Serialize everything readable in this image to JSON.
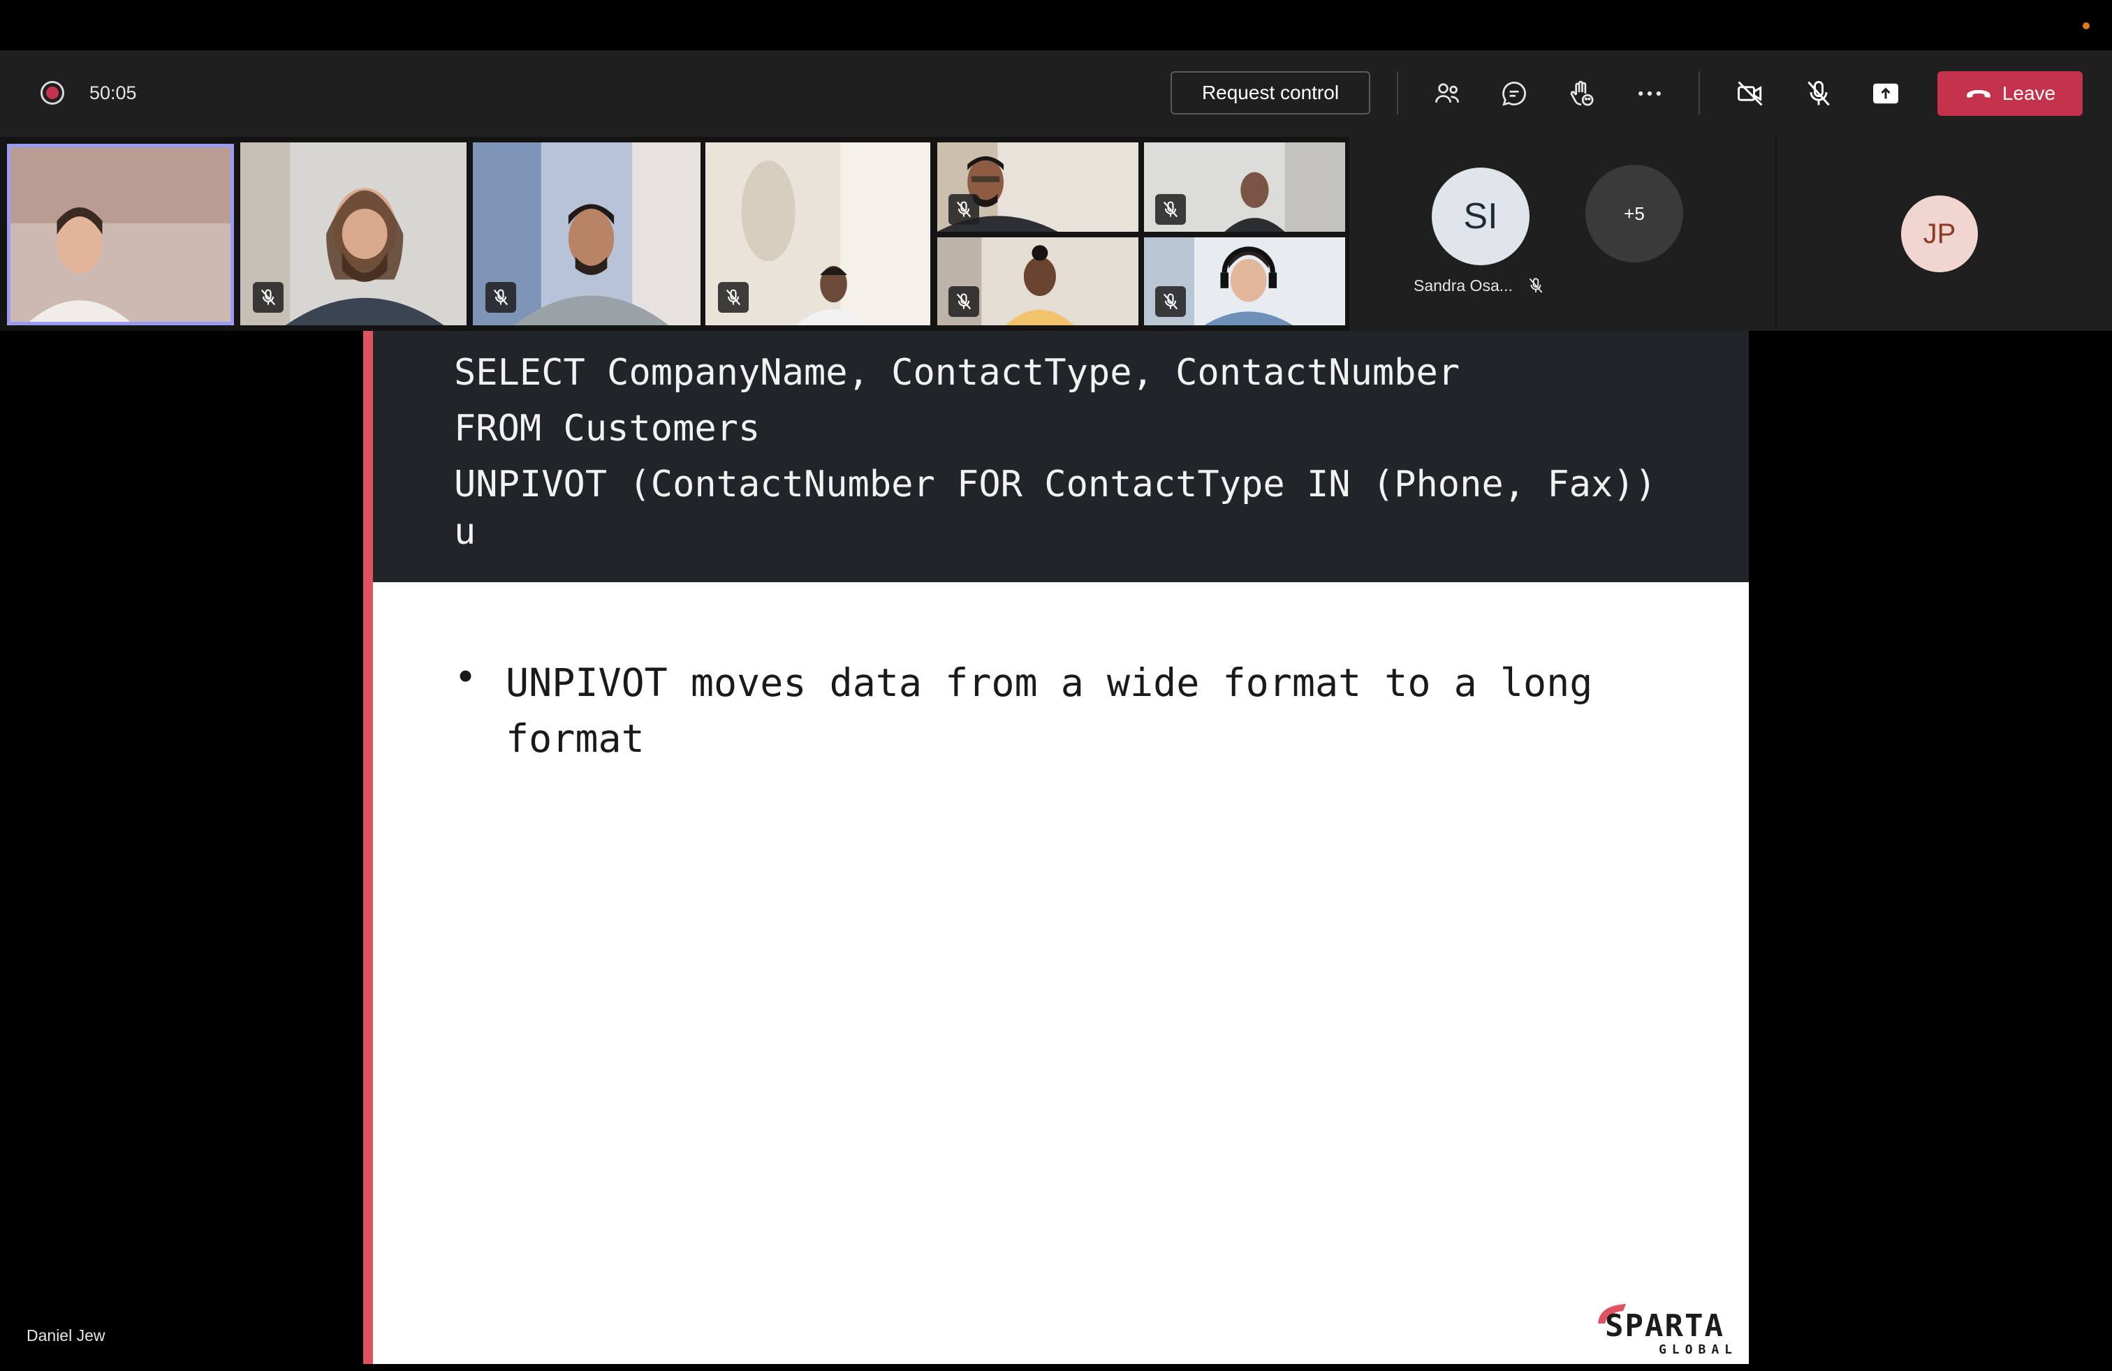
{
  "meeting": {
    "timer": "50:05",
    "request_control_label": "Request control",
    "leave_label": "Leave",
    "colors": {
      "leave": "#c4314b",
      "selected_tile": "#9a9bf5",
      "slide_accent": "#e05260"
    }
  },
  "toolbar_icons": [
    "people-icon",
    "chat-icon",
    "raise-hand-icon",
    "more-icon",
    "camera-off-icon",
    "mic-off-icon",
    "share-screen-icon"
  ],
  "participants": {
    "avatar_si": {
      "initials": "SI",
      "name": "Sandra Osa..."
    },
    "overflow": "+5",
    "avatar_jp": {
      "initials": "JP"
    }
  },
  "slide": {
    "code_lines": [
      "SELECT CompanyName, ContactType, ContactNumber",
      "FROM Customers",
      "UNPIVOT (ContactNumber FOR ContactType IN (Phone, Fax))",
      "u"
    ],
    "bullet": "UNPIVOT moves data from a wide format to a long format",
    "logo_word": "SPARTA",
    "logo_sub": "GLOBAL"
  },
  "presenter_name": "Daniel Jew"
}
